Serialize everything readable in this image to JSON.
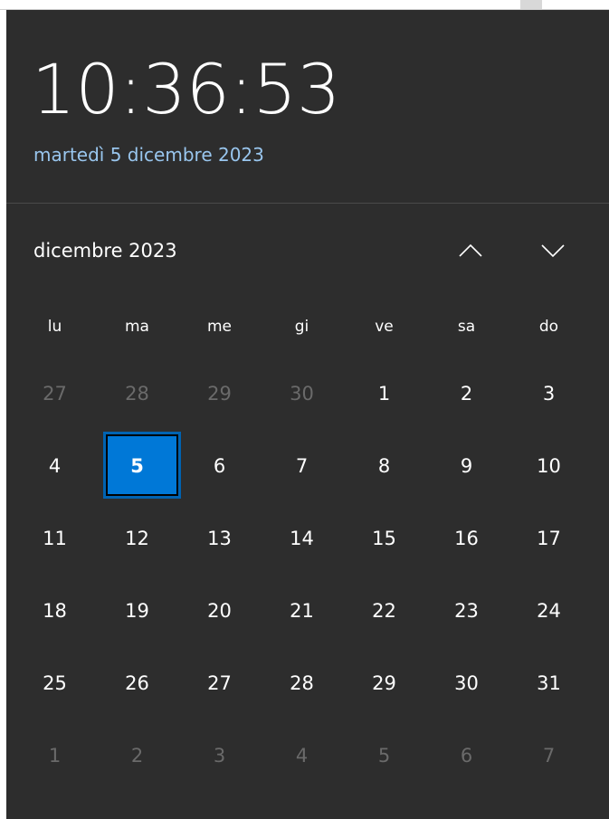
{
  "clock": {
    "time": "10:36:53",
    "date_long": "martedì 5 dicembre 2023"
  },
  "calendar": {
    "month_label": "dicembre 2023",
    "prev_icon": "chevron-up-icon",
    "next_icon": "chevron-down-icon",
    "weekdays": [
      "lu",
      "ma",
      "me",
      "gi",
      "ve",
      "sa",
      "do"
    ],
    "selected_day": "5",
    "weeks": [
      [
        "27",
        "28",
        "29",
        "30",
        "1",
        "2",
        "3"
      ],
      [
        "4",
        "5",
        "6",
        "7",
        "8",
        "9",
        "10"
      ],
      [
        "11",
        "12",
        "13",
        "14",
        "15",
        "16",
        "17"
      ],
      [
        "18",
        "19",
        "20",
        "21",
        "22",
        "23",
        "24"
      ],
      [
        "25",
        "26",
        "27",
        "28",
        "29",
        "30",
        "31"
      ],
      [
        "1",
        "2",
        "3",
        "4",
        "5",
        "6",
        "7"
      ]
    ]
  },
  "colors": {
    "panel_bg": "#2d2d2d",
    "date_link": "#99c6ee",
    "accent": "#0078d7",
    "out_of_month_text": "#6a6a6a"
  }
}
